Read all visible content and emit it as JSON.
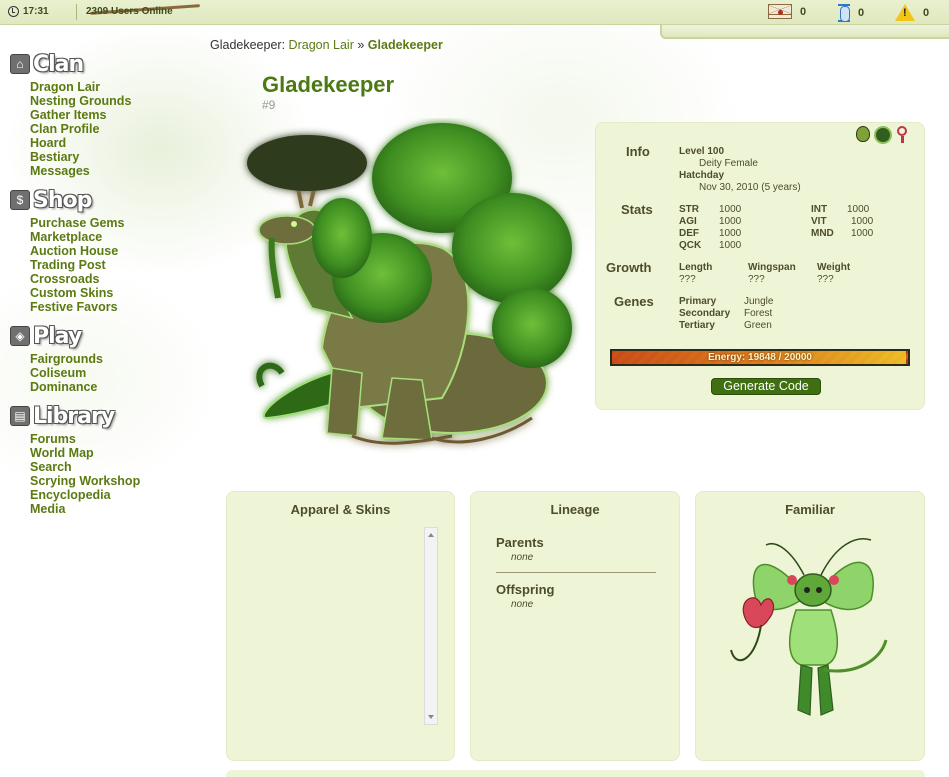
{
  "topbar": {
    "time": "17:31",
    "users_online": "2309 Users Online",
    "mail_count": "0",
    "timer_count": "0",
    "alert_count": "0"
  },
  "sidebar": {
    "sections": [
      {
        "title": "Clan",
        "icon": "home-icon",
        "links": [
          "Dragon Lair",
          "Nesting Grounds",
          "Gather Items",
          "Clan Profile",
          "Hoard",
          "Bestiary",
          "Messages"
        ]
      },
      {
        "title": "Shop",
        "icon": "shop-icon",
        "links": [
          "Purchase Gems",
          "Marketplace",
          "Auction House",
          "Trading Post",
          "Crossroads",
          "Custom Skins",
          "Festive Favors"
        ]
      },
      {
        "title": "Play",
        "icon": "play-icon",
        "links": [
          "Fairgrounds",
          "Coliseum",
          "Dominance"
        ]
      },
      {
        "title": "Library",
        "icon": "book-icon",
        "links": [
          "Forums",
          "World Map",
          "Search",
          "Scrying Workshop",
          "Encyclopedia",
          "Media"
        ]
      }
    ]
  },
  "breadcrumb": {
    "owner": "Gladekeeper:",
    "link": "Dragon Lair",
    "separator": "»",
    "current": "Gladekeeper"
  },
  "dragon": {
    "name": "Gladekeeper",
    "id": "#9",
    "info_label": "Info",
    "level": "Level 100",
    "type_gender": "Deity Female",
    "hatchday_label": "Hatchday",
    "hatchday": "Nov 30, 2010 (5 years)",
    "stats_label": "Stats",
    "stats": [
      {
        "name": "STR",
        "value": "1000"
      },
      {
        "name": "AGI",
        "value": "1000"
      },
      {
        "name": "DEF",
        "value": "1000"
      },
      {
        "name": "QCK",
        "value": "1000"
      },
      {
        "name": "INT",
        "value": "1000"
      },
      {
        "name": "VIT",
        "value": "1000"
      },
      {
        "name": "MND",
        "value": "1000"
      }
    ],
    "growth_label": "Growth",
    "growth": [
      {
        "name": "Length",
        "value": "???"
      },
      {
        "name": "Wingspan",
        "value": "???"
      },
      {
        "name": "Weight",
        "value": "???"
      }
    ],
    "genes_label": "Genes",
    "genes": [
      {
        "name": "Primary",
        "value": "Jungle"
      },
      {
        "name": "Secondary",
        "value": "Forest"
      },
      {
        "name": "Tertiary",
        "value": "Green"
      }
    ],
    "energy_text": "Energy: 19848 / 20000",
    "energy_fraction": 0.9924,
    "generate_code": "Generate Code"
  },
  "panels": {
    "apparel_title": "Apparel & Skins",
    "lineage_title": "Lineage",
    "parents_label": "Parents",
    "parents_value": "none",
    "offspring_label": "Offspring",
    "offspring_value": "none",
    "familiar_title": "Familiar"
  },
  "colors": {
    "accent_green": "#5b7a12",
    "panel_bg": "#eef5d6",
    "button_green": "#3f6f10"
  }
}
